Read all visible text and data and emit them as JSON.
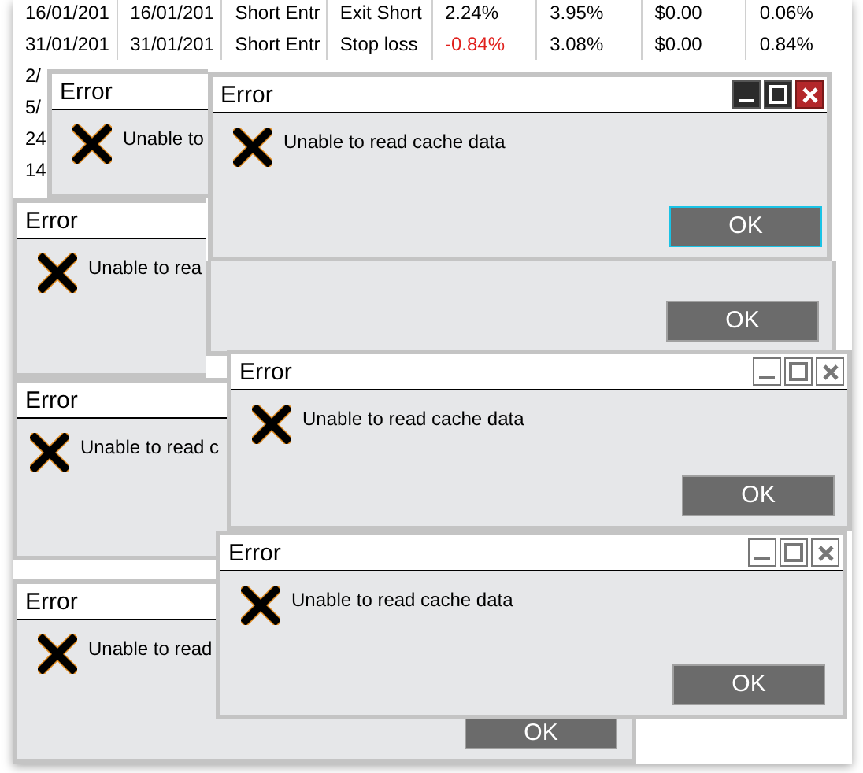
{
  "table": {
    "rows": [
      {
        "cells": [
          {
            "text": "16/01/201",
            "negative": false
          },
          {
            "text": "16/01/201",
            "negative": false
          },
          {
            "text": "Short Entr",
            "negative": false
          },
          {
            "text": "Exit Short",
            "negative": false
          },
          {
            "text": "2.24%",
            "negative": false
          },
          {
            "text": "3.95%",
            "negative": false
          },
          {
            "text": "$0.00",
            "negative": false
          },
          {
            "text": "0.06%",
            "negative": false
          }
        ]
      },
      {
        "cells": [
          {
            "text": "31/01/201",
            "negative": false
          },
          {
            "text": "31/01/201",
            "negative": false
          },
          {
            "text": "Short Entr",
            "negative": false
          },
          {
            "text": "Stop loss",
            "negative": false
          },
          {
            "text": "-0.84%",
            "negative": true
          },
          {
            "text": "3.08%",
            "negative": false
          },
          {
            "text": "$0.00",
            "negative": false
          },
          {
            "text": "0.84%",
            "negative": false
          }
        ]
      },
      {
        "cells": [
          {
            "text": "2/",
            "negative": false
          }
        ]
      },
      {
        "cells": [
          {
            "text": "5/",
            "negative": false
          }
        ]
      },
      {
        "cells": [
          {
            "text": "24",
            "negative": false
          }
        ]
      },
      {
        "cells": [
          {
            "text": "14",
            "negative": false
          }
        ]
      }
    ]
  },
  "windows": [
    {
      "title": "Error",
      "message": "Unable to"
    },
    {
      "title": "Error",
      "message": "Unable to read cache data",
      "ok": "OK",
      "title_buttons": true,
      "active": true
    },
    {
      "title": "Error",
      "message": "Unable to rea"
    },
    {
      "ok": "OK"
    },
    {
      "title": "Error",
      "message": "Unable to read c"
    },
    {
      "title": "Error",
      "message": "Unable to read cache data",
      "ok": "OK",
      "title_buttons": true,
      "active": false
    },
    {
      "title": "Error",
      "message": "Unable to read",
      "ok": "OK"
    },
    {
      "title": "Error",
      "message": "Unable to read cache data",
      "ok": "OK",
      "title_buttons": true,
      "active": false
    }
  ]
}
